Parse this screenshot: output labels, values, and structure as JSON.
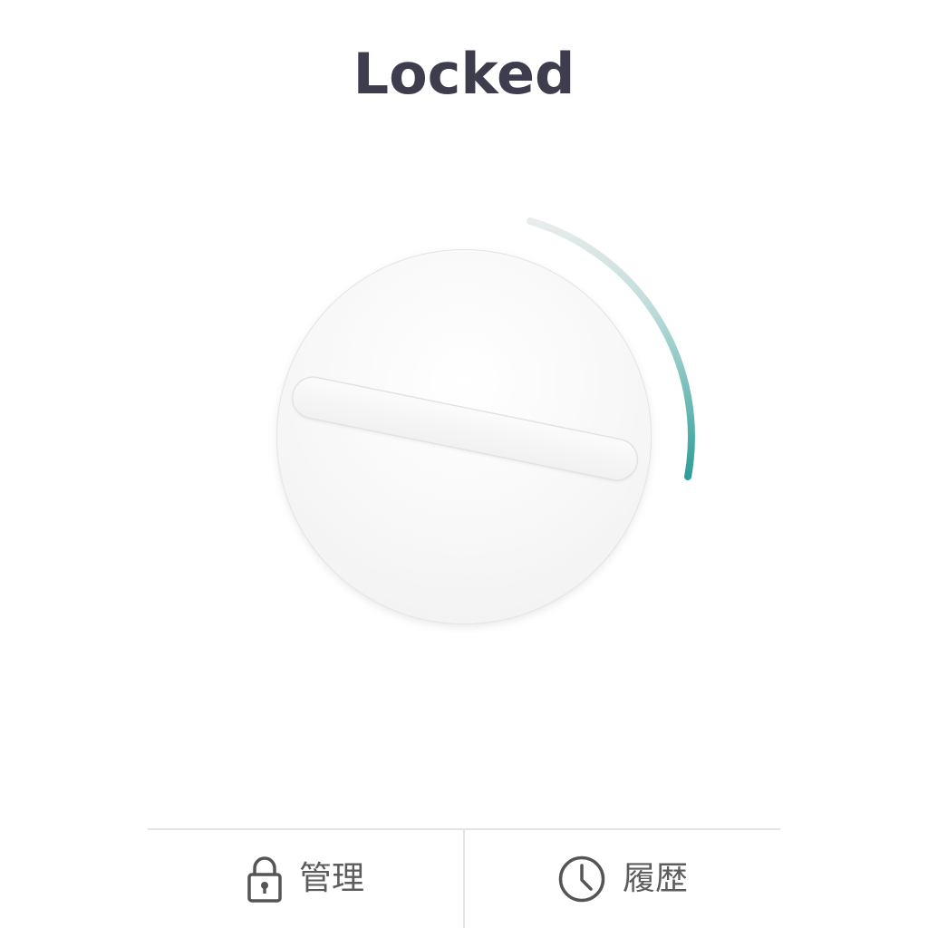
{
  "status": {
    "title": "Locked"
  },
  "dial": {
    "state": "locked",
    "progress_arc_color": "#2e9e98",
    "knob_icon": "thumb-turn-icon"
  },
  "bottom_nav": {
    "items": [
      {
        "label": "管理",
        "icon": "lock-icon"
      },
      {
        "label": "履歴",
        "icon": "clock-icon"
      }
    ]
  },
  "colors": {
    "title_text": "#3d3d4e",
    "nav_text": "#5c5c5c",
    "accent": "#2e9e98"
  }
}
